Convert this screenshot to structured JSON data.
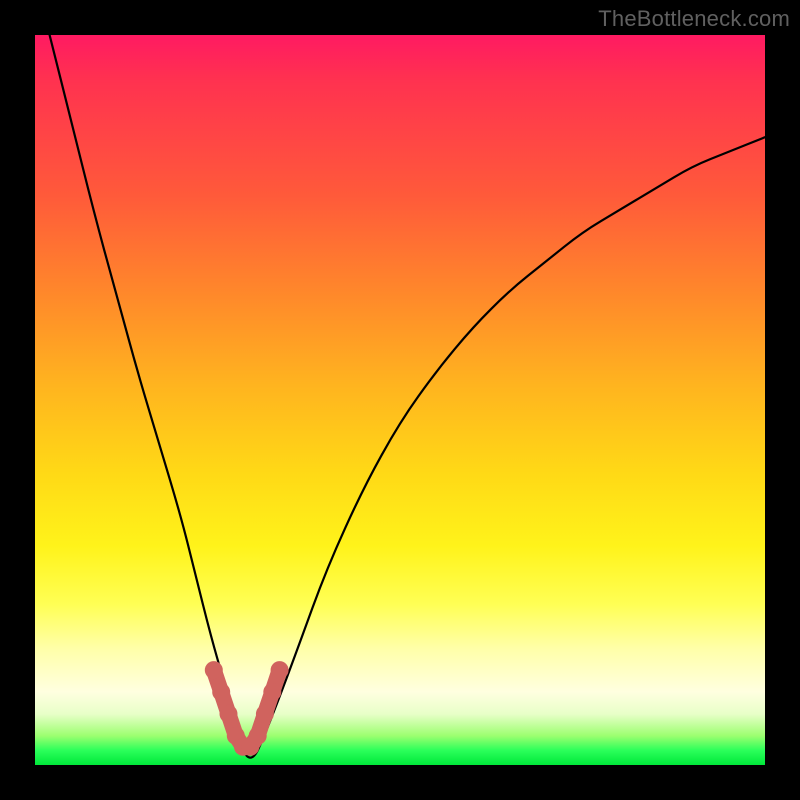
{
  "watermark": "TheBottleneck.com",
  "chart_data": {
    "type": "line",
    "title": "",
    "xlabel": "",
    "ylabel": "",
    "xlim": [
      0,
      100
    ],
    "ylim": [
      0,
      100
    ],
    "grid": false,
    "legend": false,
    "series": [
      {
        "name": "bottleneck-curve",
        "x": [
          2,
          5,
          8,
          11,
          14,
          17,
          20,
          22,
          24,
          26,
          27,
          28,
          29,
          30,
          31,
          33,
          36,
          40,
          45,
          50,
          55,
          60,
          65,
          70,
          75,
          80,
          85,
          90,
          95,
          100
        ],
        "values": [
          100,
          88,
          76,
          65,
          54,
          44,
          34,
          26,
          18,
          11,
          6,
          3,
          1,
          1,
          3,
          8,
          16,
          27,
          38,
          47,
          54,
          60,
          65,
          69,
          73,
          76,
          79,
          82,
          84,
          86
        ]
      },
      {
        "name": "optimal-zone-marker",
        "x": [
          24.5,
          25.5,
          26.5,
          27.5,
          28.5,
          29.5,
          30.5,
          31.5,
          32.5,
          33.5
        ],
        "values": [
          13,
          10,
          7,
          4,
          2.5,
          2.5,
          4,
          7,
          10,
          13
        ]
      }
    ],
    "colors": {
      "curve": "#000000",
      "marker": "#d0635e",
      "gradient_top": "#ff1a62",
      "gradient_bottom": "#00e83a"
    }
  }
}
